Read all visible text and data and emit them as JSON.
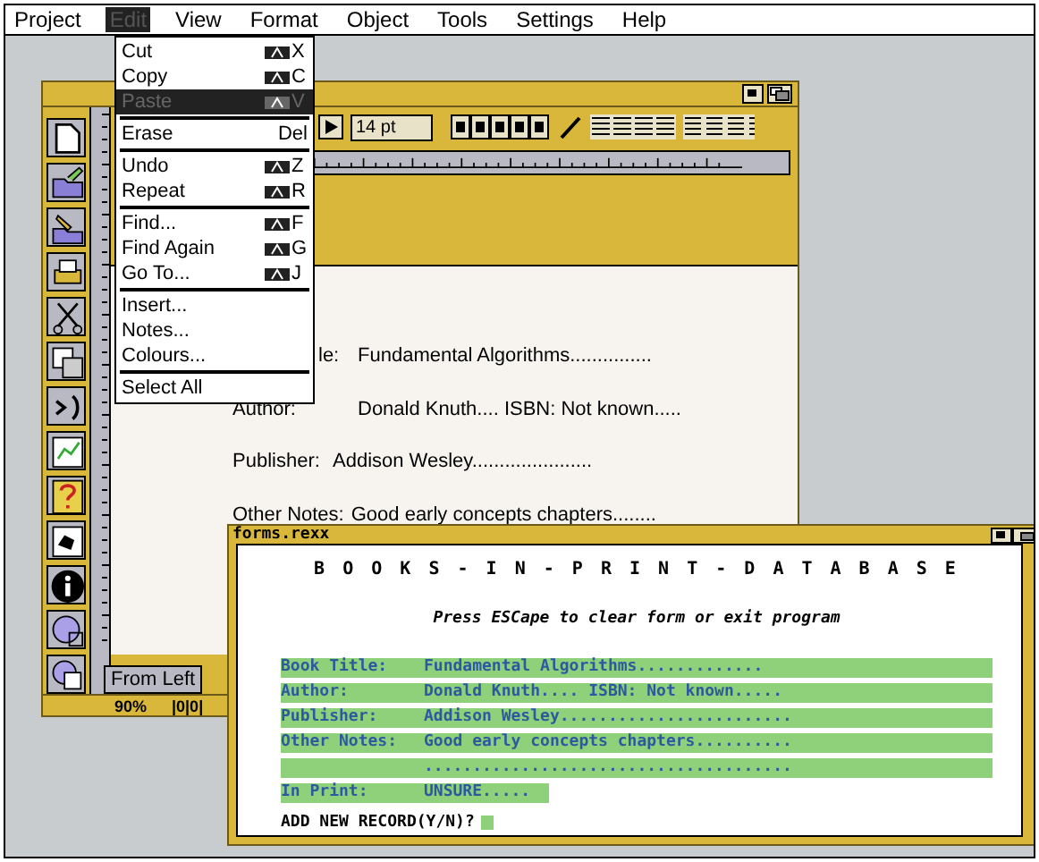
{
  "menu_bar": [
    {
      "label": "Project",
      "selected": false
    },
    {
      "label": "Edit",
      "selected": true
    },
    {
      "label": "View",
      "selected": false
    },
    {
      "label": "Format",
      "selected": false
    },
    {
      "label": "Object",
      "selected": false
    },
    {
      "label": "Tools",
      "selected": false
    },
    {
      "label": "Settings",
      "selected": false
    },
    {
      "label": "Help",
      "selected": false
    }
  ],
  "edit_menu": [
    {
      "label": "Cut",
      "kind": "amiga",
      "key": "X",
      "selected": false,
      "separator_after": false
    },
    {
      "label": "Copy",
      "kind": "amiga",
      "key": "C",
      "selected": false,
      "separator_after": false
    },
    {
      "label": "Paste",
      "kind": "amiga",
      "key": "V",
      "selected": true,
      "separator_after": true
    },
    {
      "label": "Erase",
      "kind": "plain",
      "key": "Del",
      "selected": false,
      "separator_after": true
    },
    {
      "label": "Undo",
      "kind": "amiga",
      "key": "Z",
      "selected": false,
      "separator_after": false
    },
    {
      "label": "Repeat",
      "kind": "amiga",
      "key": "R",
      "selected": false,
      "separator_after": true
    },
    {
      "label": "Find...",
      "kind": "amiga",
      "key": "F",
      "selected": false,
      "separator_after": false
    },
    {
      "label": "Find Again",
      "kind": "amiga",
      "key": "G",
      "selected": false,
      "separator_after": false
    },
    {
      "label": "Go To...",
      "kind": "amiga",
      "key": "J",
      "selected": false,
      "separator_after": true
    },
    {
      "label": "Insert...",
      "kind": "none",
      "selected": false,
      "separator_after": false
    },
    {
      "label": "Notes...",
      "kind": "none",
      "selected": false,
      "separator_after": false
    },
    {
      "label": "Colours...",
      "kind": "none",
      "selected": false,
      "separator_after": true
    },
    {
      "label": "Select All",
      "kind": "none",
      "selected": false,
      "separator_after": false
    }
  ],
  "document_window": {
    "font_size": "14 pt",
    "lines": [
      {
        "label": "le:",
        "value": "Fundamental Algorithms..............."
      },
      {
        "label": "Author:",
        "value": "Donald Knuth.... ISBN: Not known....."
      },
      {
        "label": "Publisher:",
        "value": "Addison Wesley......................"
      },
      {
        "label": "Other Notes:",
        "value": "Good early concepts chapters........"
      }
    ],
    "measure_label": "From Left",
    "status_bar": [
      "90%",
      "|0|0|"
    ]
  },
  "console_window": {
    "title": "forms.rexx",
    "heading": "B O O K S - I N - P R I N T - D A T A B A S E",
    "instruction": "Press ESCape to clear form or exit program",
    "fields": [
      {
        "label": "Book Title:",
        "value": "Fundamental Algorithms............."
      },
      {
        "label": "Author:",
        "value": "Donald Knuth....  ISBN: Not known....."
      },
      {
        "label": "Publisher:",
        "value": "Addison Wesley........................"
      },
      {
        "label": "Other Notes:",
        "value": "Good early concepts chapters.........."
      },
      {
        "value": "......................................"
      },
      {
        "label": "In Print:",
        "value": "UNSURE....."
      }
    ],
    "prompt": "ADD NEW RECORD(Y/N)?"
  }
}
